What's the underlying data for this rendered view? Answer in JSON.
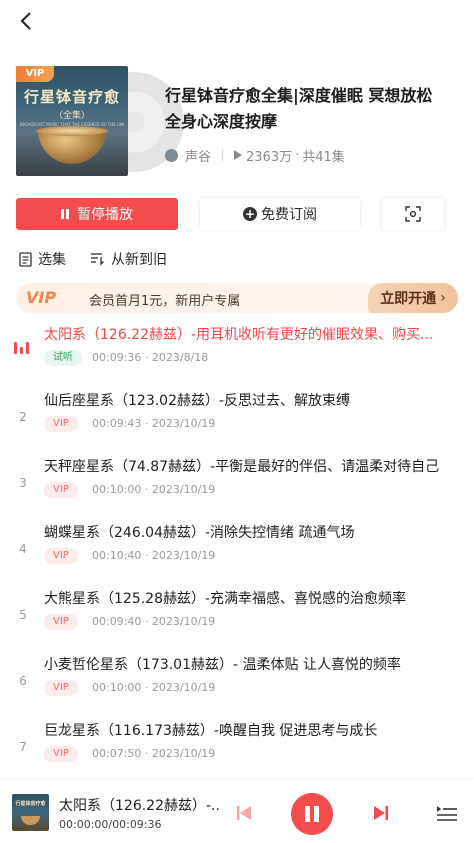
{
  "nav": {
    "back_icon": "chevron-left-icon"
  },
  "album": {
    "cover_badge": "VIP",
    "cover_title": "行星钵音疗愈",
    "cover_subtitle": "（全集）",
    "cover_tagline": "BROADCAST MUSIC THAT THE ESSENCE OF THE UNIVERSE",
    "title": "行星钵音疗愈全集|深度催眠 冥想放松全身心深度按摩",
    "author": "声谷",
    "plays": "2363万",
    "episodes": "共41集",
    "plays_separator": "·"
  },
  "actions": {
    "pause_label": "暂停播放",
    "subscribe_label": "免费订阅"
  },
  "toolbar": {
    "select_label": "选集",
    "sort_label": "从新到旧"
  },
  "vip_banner": {
    "logo": "VIP",
    "text": "会员首月1元，新用户专属",
    "cta": "立即开通"
  },
  "tracks": [
    {
      "num": "",
      "title": "太阳系（126.22赫兹）-用耳机收听有更好的催眠效果、购买...",
      "badge": "试听",
      "badge_type": "trial",
      "info": "00:09:36 · 2023/8/18",
      "active": true
    },
    {
      "num": "2",
      "title": "仙后座星系（123.02赫兹）-反思过去、解放束缚",
      "badge": "VIP",
      "badge_type": "vip",
      "info": "00:09:43 · 2023/10/19",
      "active": false
    },
    {
      "num": "3",
      "title": "天秤座星系（74.87赫兹）-平衡是最好的伴侣、请温柔对待自己",
      "badge": "VIP",
      "badge_type": "vip",
      "info": "00:10:00 · 2023/10/19",
      "active": false
    },
    {
      "num": "4",
      "title": "蝴蝶星系（246.04赫兹）-消除失控情绪 疏通气场",
      "badge": "VIP",
      "badge_type": "vip",
      "info": "00:10:40 · 2023/10/19",
      "active": false
    },
    {
      "num": "5",
      "title": "大熊星系（125.28赫兹）-充满幸福感、喜悦感的治愈频率",
      "badge": "VIP",
      "badge_type": "vip",
      "info": "00:09:40 · 2023/10/19",
      "active": false
    },
    {
      "num": "6",
      "title": "小麦哲伦星系（173.01赫兹）- 温柔体贴 让人喜悦的频率",
      "badge": "VIP",
      "badge_type": "vip",
      "info": "00:10:00 · 2023/10/19",
      "active": false
    },
    {
      "num": "7",
      "title": "巨龙星系（116.173赫兹）-唤醒自我 促进思考与成长",
      "badge": "VIP",
      "badge_type": "vip",
      "info": "00:07:50 · 2023/10/19",
      "active": false
    }
  ],
  "player": {
    "cover_text": "行星钵音疗愈",
    "title": "太阳系（126.22赫兹）-...",
    "time": "00:00:00/00:09:36"
  },
  "colors": {
    "accent": "#f34c4c",
    "vip": "#f0854d",
    "trial": "#34a46a"
  }
}
